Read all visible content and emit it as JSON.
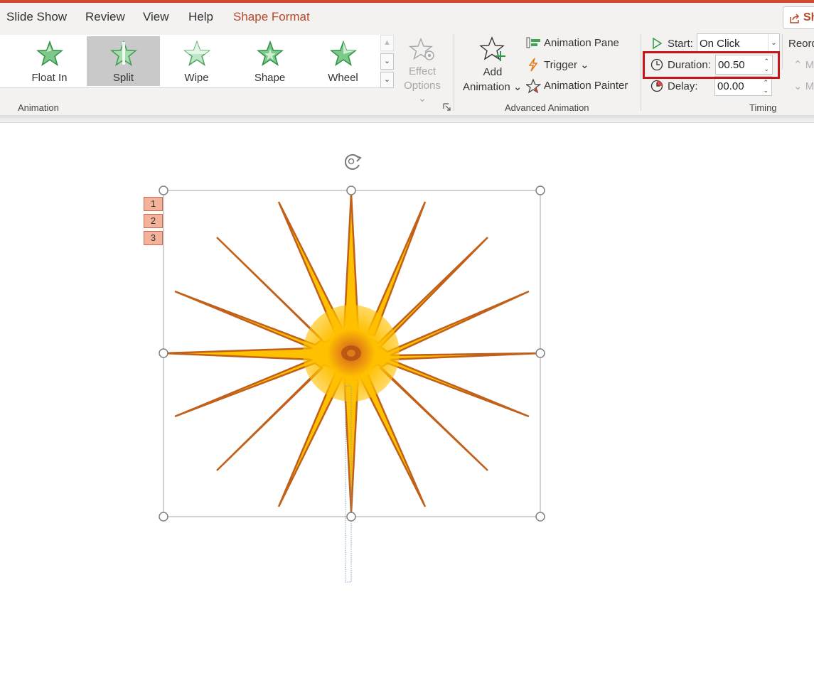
{
  "tabs": [
    {
      "label": "Slide Show",
      "active": false
    },
    {
      "label": "Review",
      "active": false
    },
    {
      "label": "View",
      "active": false
    },
    {
      "label": "Help",
      "active": false
    },
    {
      "label": "Shape Format",
      "active": true
    }
  ],
  "share_button_label": "Sh",
  "animation_group": {
    "label": "Animation",
    "gallery": [
      {
        "label": "Float In",
        "selected": false
      },
      {
        "label": "Split",
        "selected": true
      },
      {
        "label": "Wipe",
        "selected": false
      },
      {
        "label": "Shape",
        "selected": false
      },
      {
        "label": "Wheel",
        "selected": false
      }
    ],
    "effect_options": {
      "line1": "Effect",
      "line2": "Options"
    }
  },
  "advanced_animation": {
    "label": "Advanced Animation",
    "add_animation": {
      "line1": "Add",
      "line2": "Animation"
    },
    "animation_pane": "Animation Pane",
    "trigger": "Trigger",
    "animation_painter": "Animation Painter"
  },
  "timing": {
    "label": "Timing",
    "start_label": "Start:",
    "start_value": "On Click",
    "duration_label": "Duration:",
    "duration_value": "00.50",
    "delay_label": "Delay:",
    "delay_value": "00.00"
  },
  "reorder": {
    "label": "Reord",
    "move_earlier": "M",
    "move_later": "M"
  },
  "animation_sequence_tags": [
    "1",
    "2",
    "3"
  ],
  "colors": {
    "accent": "#b7472a",
    "star_fill": "#ffc000",
    "star_edge": "#c0601a",
    "highlight": "#c8151a",
    "tag_fill": "#f4b29a"
  }
}
